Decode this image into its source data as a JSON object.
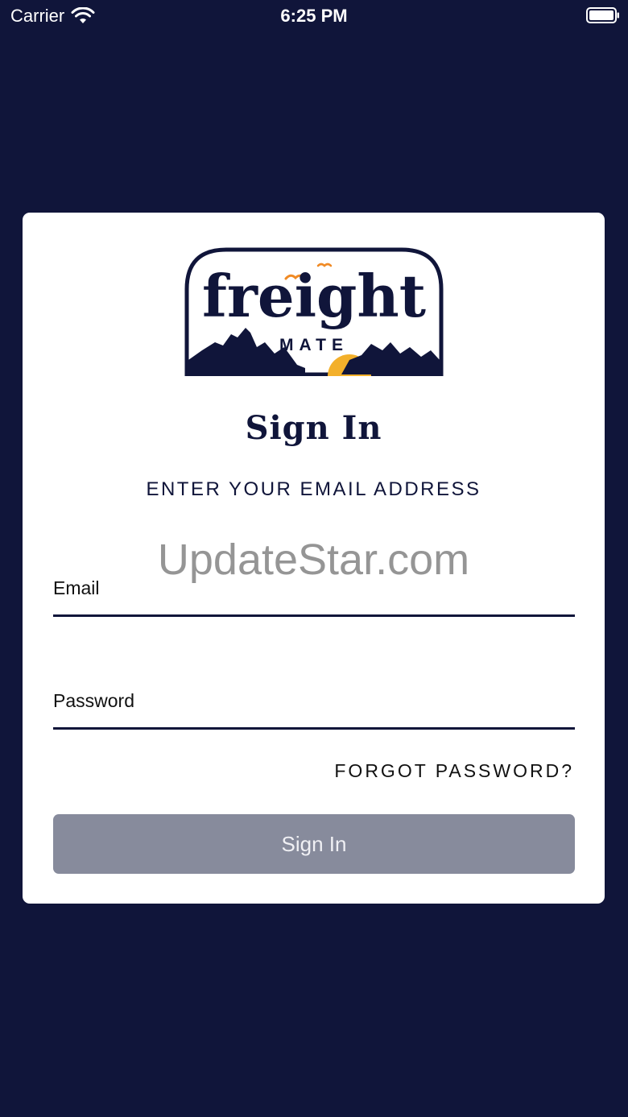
{
  "status_bar": {
    "carrier": "Carrier",
    "time": "6:25 PM"
  },
  "logo": {
    "wordmark": "freight",
    "tagline": "MATE"
  },
  "signin": {
    "title": "Sign In",
    "subtitle": "ENTER YOUR EMAIL ADDRESS",
    "watermark": "UpdateStar.com",
    "email_label": "Email",
    "password_label": "Password",
    "forgot_label": "FORGOT PASSWORD?",
    "button_label": "Sign In"
  },
  "colors": {
    "background": "#10153a",
    "card": "#ffffff",
    "button": "#878b9c",
    "accent_orange": "#f08a24",
    "accent_sun": "#f3b02b"
  }
}
